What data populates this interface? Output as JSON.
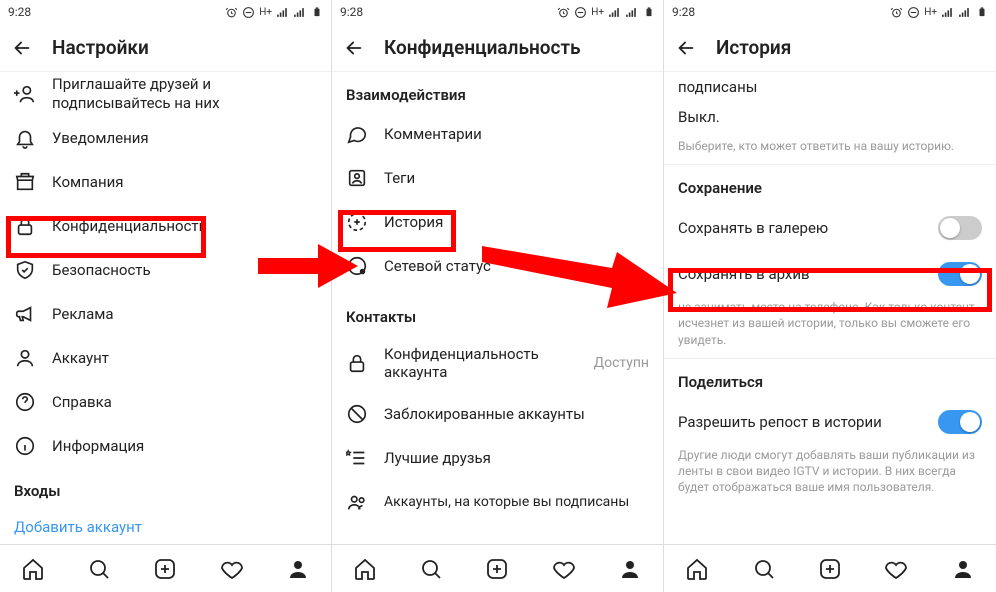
{
  "statusbar": {
    "time": "9:28"
  },
  "screen1": {
    "title": "Настройки",
    "items": {
      "invite": {
        "l1": "Приглашайте друзей и",
        "l2": "подписывайтесь на них"
      },
      "notifications": "Уведомления",
      "business": "Компания",
      "privacy": "Конфиденциальность",
      "security": "Безопасность",
      "ads": "Реклама",
      "account": "Аккаунт",
      "help": "Справка",
      "about": "Информация"
    },
    "section_logins": "Входы",
    "add_account": "Добавить аккаунт"
  },
  "screen2": {
    "title": "Конфиденциальность",
    "section_interactions": "Взаимодействия",
    "items": {
      "comments": "Комментарии",
      "tags": "Теги",
      "story": "История",
      "activity_status": "Сетевой статус"
    },
    "section_contacts": "Контакты",
    "contacts": {
      "account_privacy": "Конфиденциальность аккаунта",
      "account_privacy_val": "Доступн",
      "blocked": "Заблокированные аккаунты",
      "close_friends": "Лучшие друзья",
      "following": "Аккаунты, на которые вы подписаны"
    }
  },
  "screen3": {
    "title": "История",
    "top_stub": "подписаны",
    "off_label": "Выкл.",
    "hint_top": "Выберите, кто может ответить на вашу историю.",
    "section_save": "Сохранение",
    "save_gallery": "Сохранять в галерею",
    "save_archive": "Сохранять в архив",
    "hint_archive": "не занимать место на телефоне. Как только контент исчезнет из вашей истории, только вы сможете его увидеть.",
    "section_share": "Поделиться",
    "allow_reshare": "Разрешить репост в истории",
    "hint_reshare": "Другие люди смогут добавлять ваши публикации из ленты в свои видео IGTV и истории. В них всегда будет отображаться ваше имя пользователя."
  },
  "nav": {
    "home": "home",
    "search": "search",
    "add": "add",
    "activity": "activity",
    "profile": "profile"
  }
}
